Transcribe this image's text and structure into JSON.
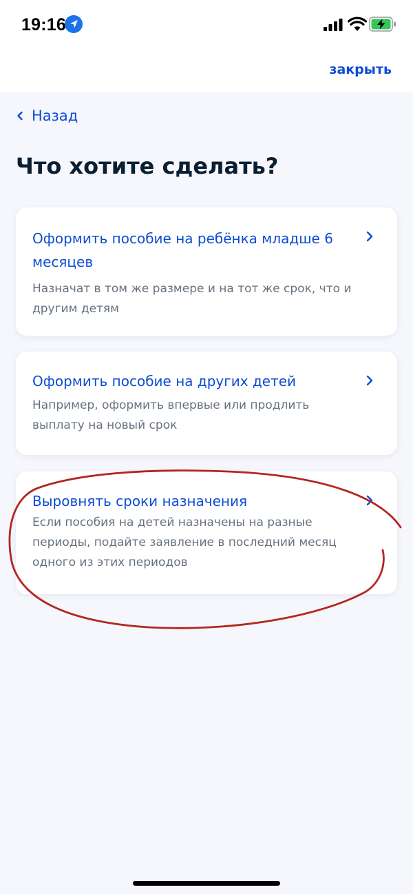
{
  "status_bar": {
    "time": "19:16",
    "icons": [
      "location-icon",
      "signal-icon",
      "wifi-icon",
      "battery-charging-icon"
    ]
  },
  "header": {
    "close_label": "закрыть"
  },
  "nav": {
    "back_label": "Назад",
    "back_icon": "chevron-left-icon"
  },
  "page_title": "Что хотите сделать?",
  "cards": [
    {
      "title": "Оформить пособие на ребёнка младше 6 месяцев",
      "description": "Назначат в том же размере и на тот же срок, что и другим детям",
      "icon": "chevron-right-icon"
    },
    {
      "title": "Оформить пособие на других детей",
      "description": "Например, оформить впервые или продлить выплату на новый срок",
      "icon": "chevron-right-icon"
    },
    {
      "title": "Выровнять сроки назначения",
      "description": "Если пособия на детей назначены на разные периоды, подайте заявление в последний месяц одного из этих периодов",
      "icon": "chevron-right-icon"
    }
  ],
  "colors": {
    "accent": "#0d4cd3",
    "text_primary": "#0b1f33",
    "text_secondary": "#66727f",
    "background": "#f5f7fc",
    "annotation": "#b3261e"
  }
}
